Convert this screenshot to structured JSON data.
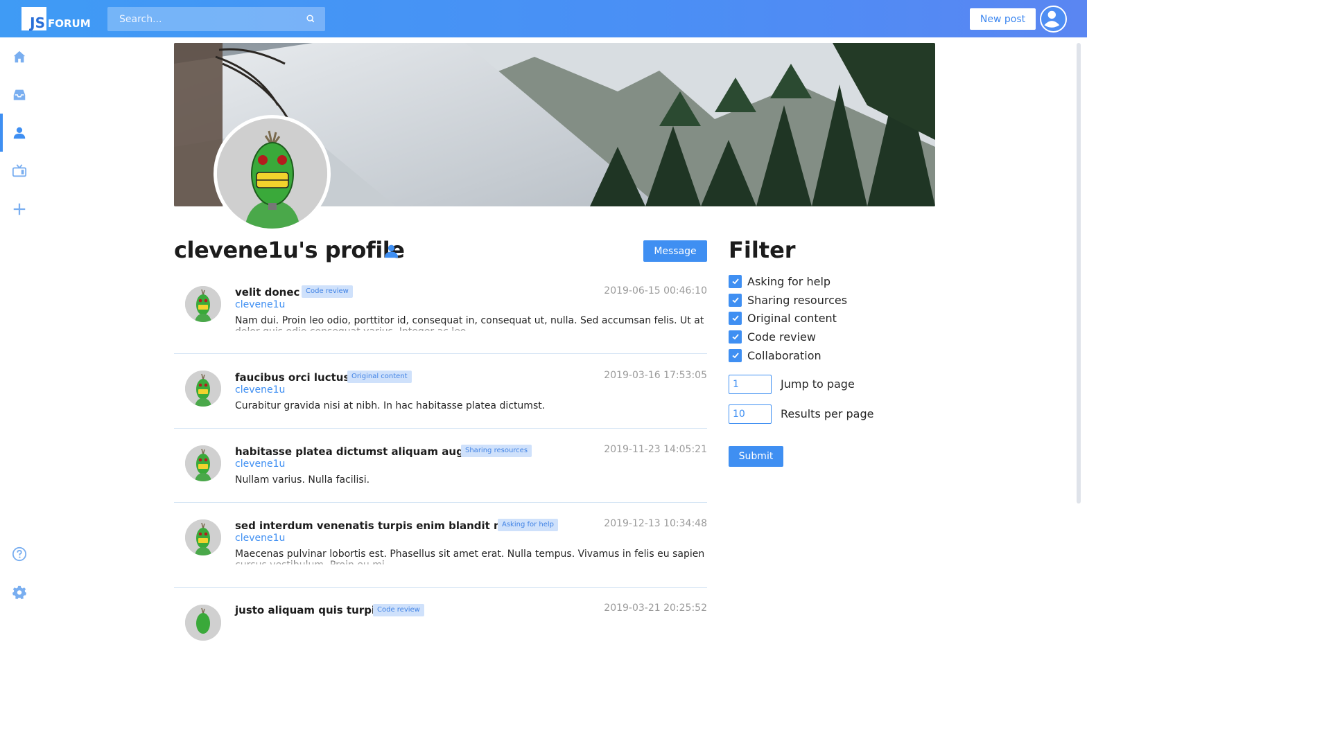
{
  "header": {
    "logo_js": "JS",
    "logo_forum": "FORUM",
    "search_placeholder": "Search...",
    "new_post_label": "New post"
  },
  "sidebar": {
    "items": [
      {
        "icon": "home-icon",
        "active": false
      },
      {
        "icon": "inbox-icon",
        "active": false
      },
      {
        "icon": "user-icon",
        "active": true
      },
      {
        "icon": "tv-icon",
        "active": false
      },
      {
        "icon": "plus-icon",
        "active": false
      },
      {
        "icon": "help-icon",
        "active": false
      },
      {
        "icon": "gear-icon",
        "active": false
      }
    ]
  },
  "profile": {
    "title": "clevene1u's profile",
    "message_label": "Message"
  },
  "posts": [
    {
      "title": "velit donec",
      "tag": "Code review",
      "author": "clevene1u",
      "date": "2019-06-15 00:46:10",
      "body": "Nam dui. Proin leo odio, porttitor id, consequat in, consequat ut, nulla. Sed accumsan felis. Ut at dolor quis odio consequat varius. Integer ac leo."
    },
    {
      "title": "faucibus orci luctus",
      "tag": "Original content",
      "author": "clevene1u",
      "date": "2019-03-16 17:53:05",
      "body": "Curabitur gravida nisi at nibh. In hac habitasse platea dictumst."
    },
    {
      "title": "habitasse platea dictumst aliquam augue",
      "tag": "Sharing resources",
      "author": "clevene1u",
      "date": "2019-11-23 14:05:21",
      "body": "Nullam varius. Nulla facilisi."
    },
    {
      "title": "sed interdum venenatis turpis enim blandit mi in",
      "tag": "Asking for help",
      "author": "clevene1u",
      "date": "2019-12-13 10:34:48",
      "body": "Maecenas pulvinar lobortis est. Phasellus sit amet erat. Nulla tempus. Vivamus in felis eu sapien cursus vestibulum. Proin eu mi."
    },
    {
      "title": "justo aliquam quis turpis",
      "tag": "Code review",
      "author": "clevene1u",
      "date": "2019-03-21 20:25:52",
      "body": ""
    }
  ],
  "filter": {
    "title": "Filter",
    "options": [
      {
        "label": "Asking for help",
        "checked": true
      },
      {
        "label": "Sharing resources",
        "checked": true
      },
      {
        "label": "Original content",
        "checked": true
      },
      {
        "label": "Code review",
        "checked": true
      },
      {
        "label": "Collaboration",
        "checked": true
      }
    ],
    "jump_to_page_value": "1",
    "jump_to_page_label": "Jump to page",
    "results_per_page_value": "10",
    "results_per_page_label": "Results per page",
    "submit_label": "Submit"
  },
  "colors": {
    "accent": "#3f8ff2",
    "header_start": "#3f9bf5",
    "header_end": "#5a86f2",
    "tag_bg": "#cfe1fb",
    "tag_text": "#4183e5"
  }
}
